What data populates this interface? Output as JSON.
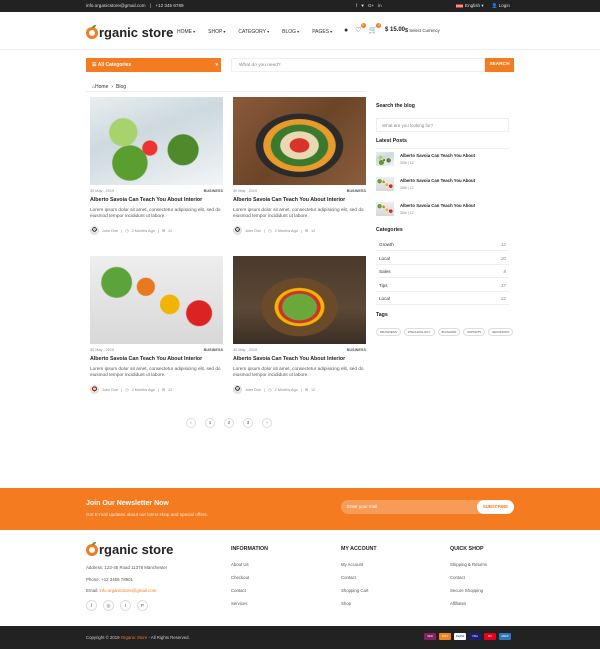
{
  "topbar": {
    "email": "info.organicstore@gmail.com",
    "separator": "|",
    "phone": "+12 345 6789",
    "social_icons": [
      "facebook-icon",
      "twitter-icon",
      "google-plus-icon",
      "linkedin-icon"
    ],
    "social_glyphs": [
      "f",
      "♥",
      "G+",
      "in"
    ],
    "language": "English",
    "login": "Login"
  },
  "header": {
    "logo_text": "rganic store",
    "nav": [
      "HOME",
      "SHOP",
      "CATEGORY",
      "BLOG",
      "PAGES"
    ],
    "wishlist_count": "0",
    "cart_count": "0",
    "cart_total": "$ 15.00",
    "currency_symbol": "$",
    "currency_label": "Select Currency"
  },
  "search": {
    "categories_label": "All Categories",
    "placeholder": "What do you need?",
    "button": "SEARCH"
  },
  "breadcrumb": {
    "home": "Home",
    "sep": "›",
    "current": "Blog"
  },
  "posts": [
    {
      "date": "30 May , 2019",
      "tag": "BUSINESS",
      "title": "Alberto Savoia Can Teach You About Interior",
      "excerpt": "Lorem ipsum dolor sit amet, consectetur adipisicing elit, sed do eiusmod tempor incididunt ut labore.",
      "author": "John Doe",
      "time": "2 Months Ago",
      "comments": "12"
    },
    {
      "date": "30 May , 2019",
      "tag": "BUSINESS",
      "title": "Alberto Savoia Can Teach You About Interior",
      "excerpt": "Lorem ipsum dolor sit amet, consectetur adipisicing elit, sed do eiusmod tempor incididunt ut labore.",
      "author": "John Doe",
      "time": "2 Months Ago",
      "comments": "12"
    },
    {
      "date": "30 May , 2019",
      "tag": "BUSINESS",
      "title": "Alberto Savoia Can Teach You About Interior",
      "excerpt": "Lorem ipsum dolor sit amet, consectetur adipisicing elit, sed do eiusmod tempor incididunt ut labore.",
      "author": "John Doe",
      "time": "2 Months Ago",
      "comments": "12"
    },
    {
      "date": "30 May , 2019",
      "tag": "BUSINESS",
      "title": "Alberto Savoia Can Teach You About Interior",
      "excerpt": "Lorem ipsum dolor sit amet, consectetur adipisicing elit, sed do eiusmod tempor incididunt ut labore.",
      "author": "John Doe",
      "time": "2 Months Ago",
      "comments": "12"
    }
  ],
  "pagination": [
    "‹",
    "1",
    "2",
    "3",
    "›"
  ],
  "sidebar": {
    "search_title": "Search the blog",
    "search_placeholder": "What are you looking for?",
    "recent_title": "Latest Posts",
    "recent": [
      {
        "title": "Alberto Savoia Can Teach You About",
        "date": "30th",
        "comments": "12"
      },
      {
        "title": "Alberto Savoia Can Teach You About",
        "date": "30th",
        "comments": "12"
      },
      {
        "title": "Alberto Savoia Can Teach You About",
        "date": "30th",
        "comments": "12"
      }
    ],
    "categories_title": "Categories",
    "categories": [
      {
        "name": "Growth",
        "count": "12"
      },
      {
        "name": "Local",
        "count": "20"
      },
      {
        "name": "Sales",
        "count": "8"
      },
      {
        "name": "Tips",
        "count": "17"
      },
      {
        "name": "Local",
        "count": "22"
      }
    ],
    "tags_title": "Tags",
    "tags": [
      "#BUSINESS",
      "#TECHNOLOGY",
      "#FASHION",
      "#SPORTS",
      "#ECONOMY"
    ]
  },
  "newsletter": {
    "title": "Join Our Newsletter Now",
    "subtitle": "Get E-mail updates about our latest shop and special offers.",
    "placeholder": "Enter your mail",
    "button": "SUBSCRIBE"
  },
  "footer": {
    "address": "Address: 123-45 Road 11378 Manchester",
    "phone": "Phone: +12 3456 78901",
    "email_label": "Email:",
    "email": "info.organicstore@gmail.com",
    "social_icons": [
      "facebook-icon",
      "instagram-icon",
      "twitter-icon",
      "pinterest-icon"
    ],
    "social_glyphs": [
      "f",
      "◎",
      "t",
      "P"
    ],
    "columns": [
      {
        "title": "INFORMATION",
        "links": [
          "About Us",
          "Checkout",
          "Contact",
          "Services"
        ]
      },
      {
        "title": "MY ACCOUNT",
        "links": [
          "My Account",
          "Contact",
          "Shopping Cart",
          "Shop"
        ]
      },
      {
        "title": "QUICK SHOP",
        "links": [
          "Shipping & Returns",
          "Contact",
          "Secure Shopping",
          "Affiliates"
        ]
      }
    ]
  },
  "bottombar": {
    "copyright_pre": "Copyright © 2019",
    "brand": "Organic Store",
    "copyright_post": "- All Rights Reserved.",
    "payments": [
      "Skrill",
      "Discover",
      "PayPal",
      "Visa",
      "Mastercard",
      "AmEx"
    ],
    "payment_labels": [
      "Skrill",
      "DISC",
      "PayPal",
      "VISA",
      "MC",
      "AMEX"
    ],
    "payment_colors": [
      "#862165",
      "#f58220",
      "#ffffff",
      "#1a1f71",
      "#eb001b",
      "#2e77bc"
    ]
  },
  "colors": {
    "accent": "#f47b20",
    "dark": "#222222"
  }
}
